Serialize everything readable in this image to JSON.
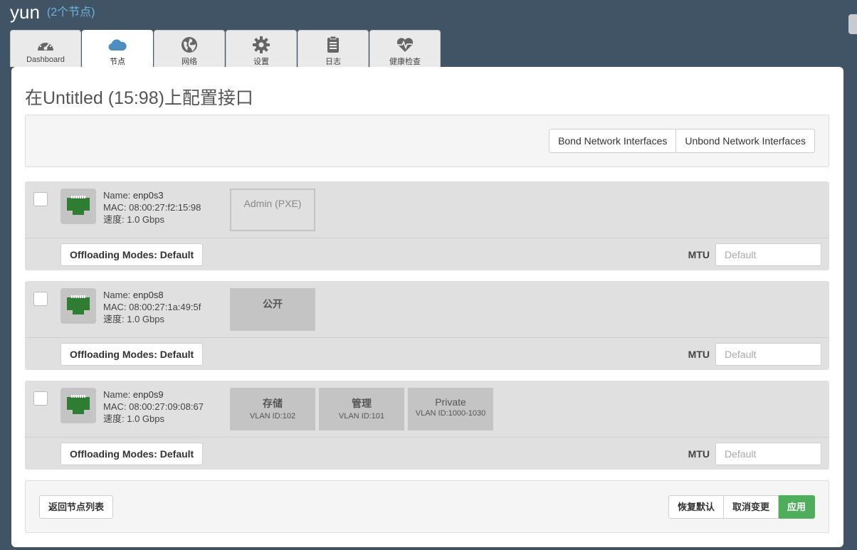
{
  "header": {
    "env_name": "yun",
    "node_count": "(2个节点)"
  },
  "tabs": [
    {
      "id": "dashboard",
      "label": "Dashboard",
      "icon": "gauge-icon",
      "active": false
    },
    {
      "id": "nodes",
      "label": "节点",
      "icon": "cloud-icon",
      "active": true
    },
    {
      "id": "network",
      "label": "网络",
      "icon": "globe-icon",
      "active": false
    },
    {
      "id": "settings",
      "label": "设置",
      "icon": "gear-icon",
      "active": false
    },
    {
      "id": "logs",
      "label": "日志",
      "icon": "clipboard-icon",
      "active": false
    },
    {
      "id": "health",
      "label": "健康检查",
      "icon": "heart-pulse-icon",
      "active": false
    }
  ],
  "page": {
    "title": "在Untitled (15:98)上配置接口"
  },
  "toolbar": {
    "bond_label": "Bond Network Interfaces",
    "unbond_label": "Unbond Network Interfaces"
  },
  "interfaces": [
    {
      "name_label": "Name:",
      "name": "enp0s3",
      "mac_label": "MAC:",
      "mac": "08:00:27:f2:15:98",
      "speed_label": "速度:",
      "speed": "1.0 Gbps",
      "networks": [
        {
          "name": "Admin (PXE)",
          "vlan": "",
          "style": "empty"
        }
      ],
      "offloading": "Offloading Modes: Default",
      "mtu_label": "MTU",
      "mtu_placeholder": "Default"
    },
    {
      "name_label": "Name:",
      "name": "enp0s8",
      "mac_label": "MAC:",
      "mac": "08:00:27:1a:49:5f",
      "speed_label": "速度:",
      "speed": "1.0 Gbps",
      "networks": [
        {
          "name": "公开",
          "vlan": "",
          "style": "bold"
        }
      ],
      "offloading": "Offloading Modes: Default",
      "mtu_label": "MTU",
      "mtu_placeholder": "Default"
    },
    {
      "name_label": "Name:",
      "name": "enp0s9",
      "mac_label": "MAC:",
      "mac": "08:00:27:09:08:67",
      "speed_label": "速度:",
      "speed": "1.0 Gbps",
      "networks": [
        {
          "name": "存储",
          "vlan": "VLAN ID:102",
          "style": "bold"
        },
        {
          "name": "管理",
          "vlan": "VLAN ID:101",
          "style": "bold"
        },
        {
          "name": "Private",
          "vlan": "VLAN ID:1000-1030",
          "style": "normal"
        }
      ],
      "offloading": "Offloading Modes: Default",
      "mtu_label": "MTU",
      "mtu_placeholder": "Default"
    }
  ],
  "footer": {
    "back_label": "返回节点列表",
    "restore_label": "恢复默认",
    "cancel_label": "取消变更",
    "apply_label": "应用"
  },
  "colors": {
    "background": "#415466",
    "apply": "#4fae5c",
    "port_green": "#2e7d32",
    "accent": "#6fb3de"
  }
}
